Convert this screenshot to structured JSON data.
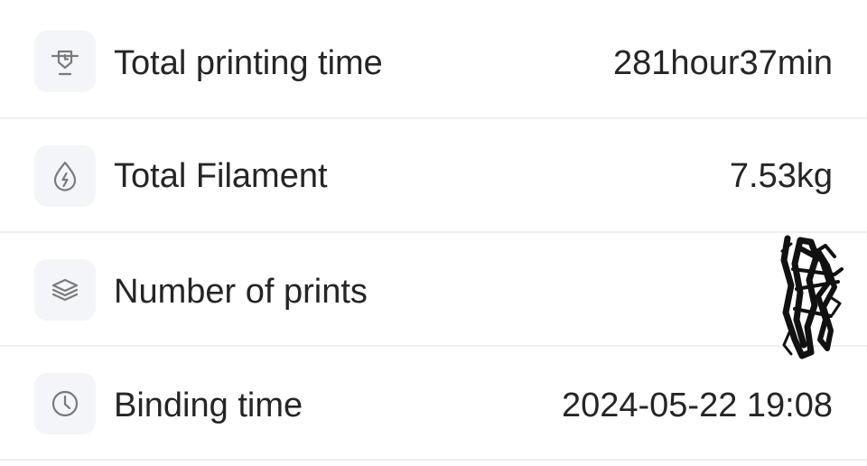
{
  "stats": [
    {
      "key": "printing-time",
      "icon": "printer-nozzle-icon",
      "label": "Total printing time",
      "value": "281hour37min"
    },
    {
      "key": "filament",
      "icon": "filament-drop-icon",
      "label": "Total Filament",
      "value": "7.53kg"
    },
    {
      "key": "number-of-prints",
      "icon": "layers-icon",
      "label": "Number of prints",
      "value": ""
    },
    {
      "key": "binding-time",
      "icon": "clock-icon",
      "label": "Binding time",
      "value": "2024-05-22 19:08"
    }
  ],
  "colors": {
    "background": "#ffffff",
    "icon_tile": "#f3f5f8",
    "icon_stroke": "#7a7a7a",
    "text": "#252525",
    "divider": "#eeeeef",
    "redaction": "#111111"
  }
}
